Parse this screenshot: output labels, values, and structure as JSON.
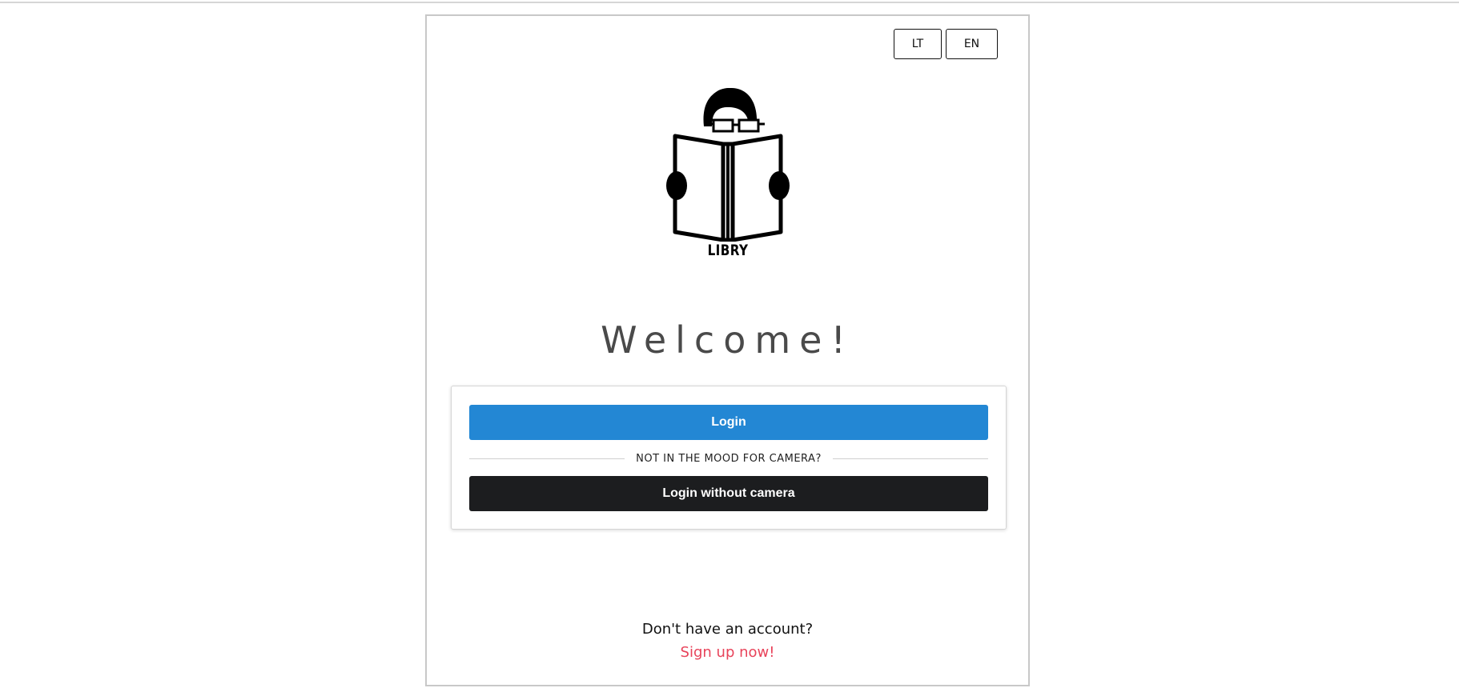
{
  "language_switch": {
    "options": [
      "LT",
      "EN"
    ]
  },
  "logo": {
    "icon": "reader-with-book-icon",
    "text": "LIBRY"
  },
  "welcome": {
    "heading": "Welcome!"
  },
  "login_card": {
    "login_label": "Login",
    "divider_label": "NOT IN THE MOOD FOR CAMERA?",
    "login_without_camera_label": "Login without camera"
  },
  "signup": {
    "prompt": "Don't have an account?",
    "link": "Sign up now!"
  },
  "colors": {
    "primary": "#2387d4",
    "dark": "#1c1d1f",
    "link": "#e8435a",
    "heading": "#4a4a4a"
  }
}
